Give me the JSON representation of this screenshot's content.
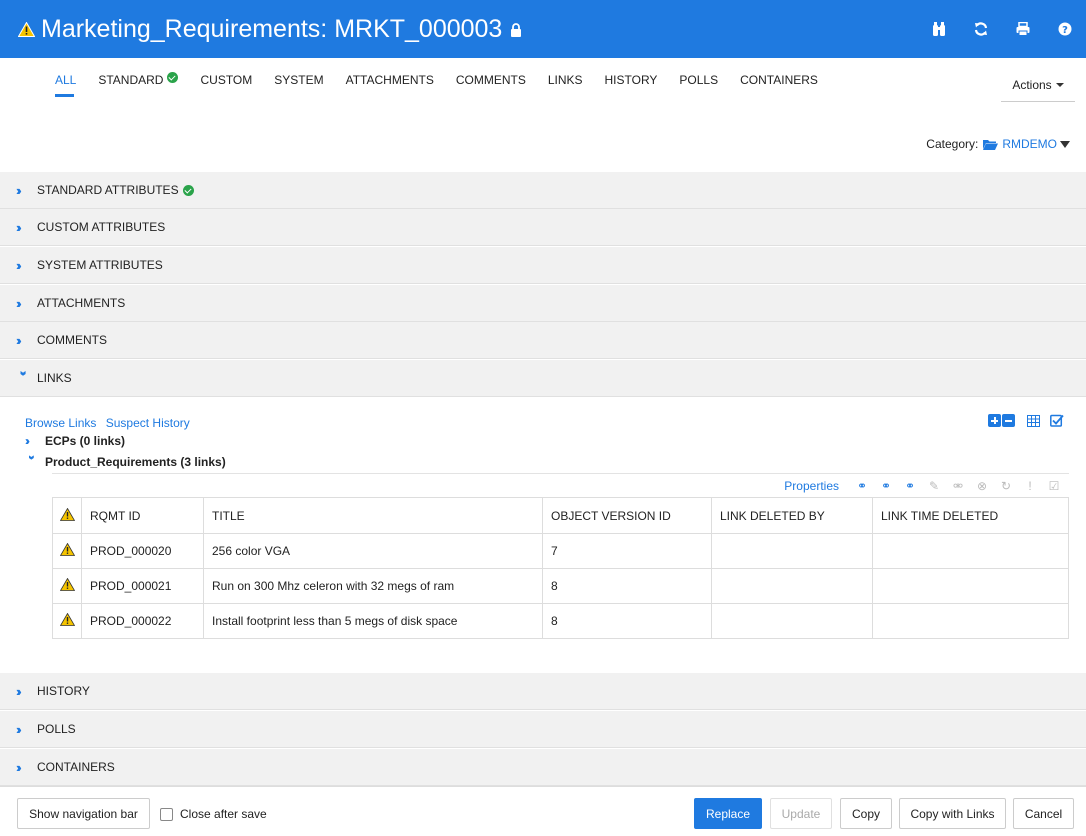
{
  "header": {
    "title": "Marketing_Requirements: MRKT_000003",
    "icons": [
      "binoculars-icon",
      "refresh-icon",
      "print-icon",
      "help-icon"
    ]
  },
  "tabs": [
    {
      "label": "ALL",
      "active": true
    },
    {
      "label": "STANDARD",
      "check": true
    },
    {
      "label": "CUSTOM"
    },
    {
      "label": "SYSTEM"
    },
    {
      "label": "ATTACHMENTS"
    },
    {
      "label": "COMMENTS"
    },
    {
      "label": "LINKS"
    },
    {
      "label": "HISTORY"
    },
    {
      "label": "POLLS"
    },
    {
      "label": "CONTAINERS"
    }
  ],
  "actions_label": "Actions",
  "category": {
    "label": "Category:",
    "value": "RMDEMO"
  },
  "sections": {
    "standard": "STANDARD ATTRIBUTES",
    "custom": "CUSTOM ATTRIBUTES",
    "system": "SYSTEM ATTRIBUTES",
    "attachments": "ATTACHMENTS",
    "comments": "COMMENTS",
    "links": "LINKS",
    "history": "HISTORY",
    "polls": "POLLS",
    "containers": "CONTAINERS"
  },
  "links_panel": {
    "browse_links": "Browse Links",
    "suspect_history": "Suspect History",
    "tree": {
      "ecps": "ECPs (0 links)",
      "product_requirements": "Product_Requirements (3 links)"
    },
    "properties_label": "Properties",
    "columns": [
      "RQMT ID",
      "TITLE",
      "OBJECT VERSION ID",
      "LINK DELETED BY",
      "LINK TIME DELETED"
    ],
    "rows": [
      {
        "id": "PROD_000020",
        "title": "256 color VGA",
        "version": "7",
        "deleted_by": "",
        "time_deleted": ""
      },
      {
        "id": "PROD_000021",
        "title": "Run on 300 Mhz celeron with 32 megs of ram",
        "version": "8",
        "deleted_by": "",
        "time_deleted": ""
      },
      {
        "id": "PROD_000022",
        "title": "Install footprint less than 5 megs of disk space",
        "version": "8",
        "deleted_by": "",
        "time_deleted": ""
      }
    ]
  },
  "footer": {
    "show_nav": "Show navigation bar",
    "close_after_save": "Close after save",
    "replace": "Replace",
    "update": "Update",
    "copy": "Copy",
    "copy_with_links": "Copy with Links",
    "cancel": "Cancel"
  },
  "colors": {
    "accent": "#1f7ae0",
    "check": "#2aa34a",
    "warning": "#f5c400"
  }
}
